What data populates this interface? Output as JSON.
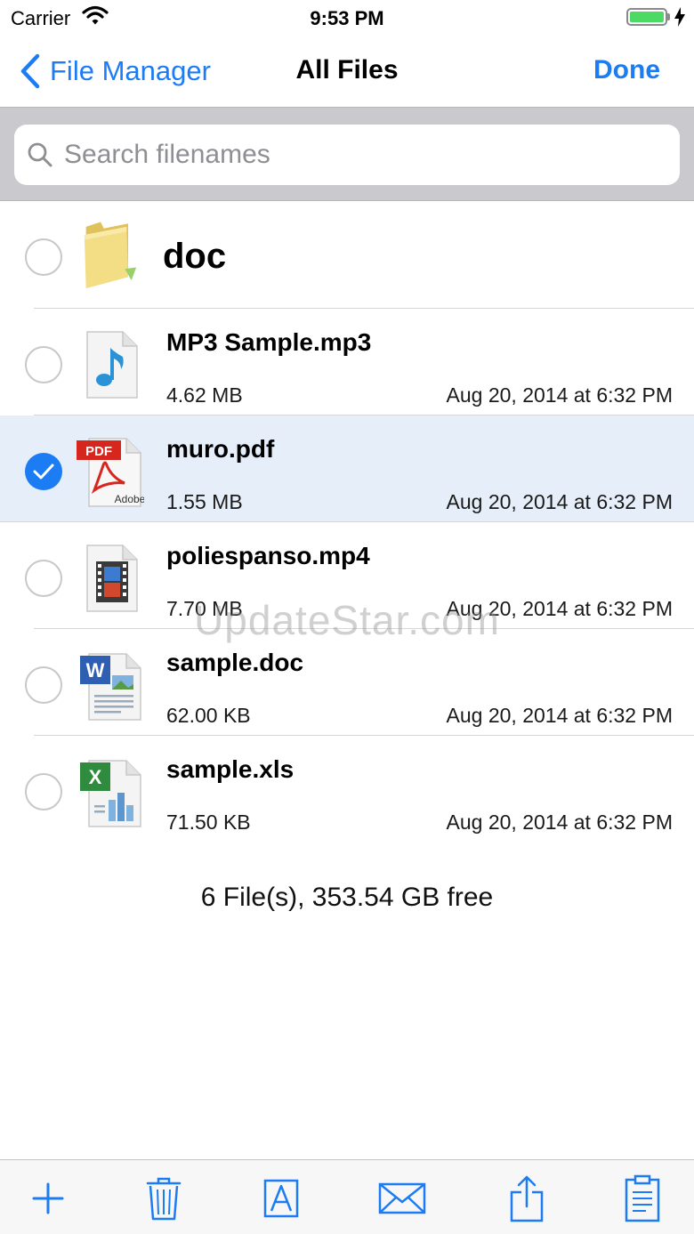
{
  "status_bar": {
    "carrier": "Carrier",
    "time": "9:53 PM",
    "battery_color": "#4cd964"
  },
  "nav": {
    "back_label": "File Manager",
    "title": "All Files",
    "done_label": "Done",
    "accent_color": "#1c7cf4"
  },
  "search": {
    "placeholder": "Search filenames",
    "value": ""
  },
  "folders": [
    {
      "name": "doc",
      "icon": "folder-icon",
      "selected": false
    }
  ],
  "files": [
    {
      "name": "MP3 Sample.mp3",
      "size": "4.62 MB",
      "date": "Aug 20, 2014 at 6:32 PM",
      "icon": "audio-file-icon",
      "selected": false
    },
    {
      "name": "muro.pdf",
      "size": "1.55 MB",
      "date": "Aug 20, 2014 at 6:32 PM",
      "icon": "pdf-file-icon",
      "selected": true
    },
    {
      "name": "poliespanso.mp4",
      "size": "7.70 MB",
      "date": "Aug 20, 2014 at 6:32 PM",
      "icon": "video-file-icon",
      "selected": false
    },
    {
      "name": "sample.doc",
      "size": "62.00 KB",
      "date": "Aug 20, 2014 at 6:32 PM",
      "icon": "word-file-icon",
      "selected": false
    },
    {
      "name": "sample.xls",
      "size": "71.50 KB",
      "date": "Aug 20, 2014 at 6:32 PM",
      "icon": "excel-file-icon",
      "selected": false
    }
  ],
  "footer_info": "6 File(s), 353.54 GB free",
  "watermark": "UpdateStar.com",
  "pdf_badge": "PDF",
  "pdf_brand": "Adobe",
  "toolbar": [
    {
      "icon": "add-icon"
    },
    {
      "icon": "trash-icon"
    },
    {
      "icon": "rename-icon"
    },
    {
      "icon": "mail-icon"
    },
    {
      "icon": "share-icon"
    },
    {
      "icon": "clipboard-icon"
    }
  ]
}
